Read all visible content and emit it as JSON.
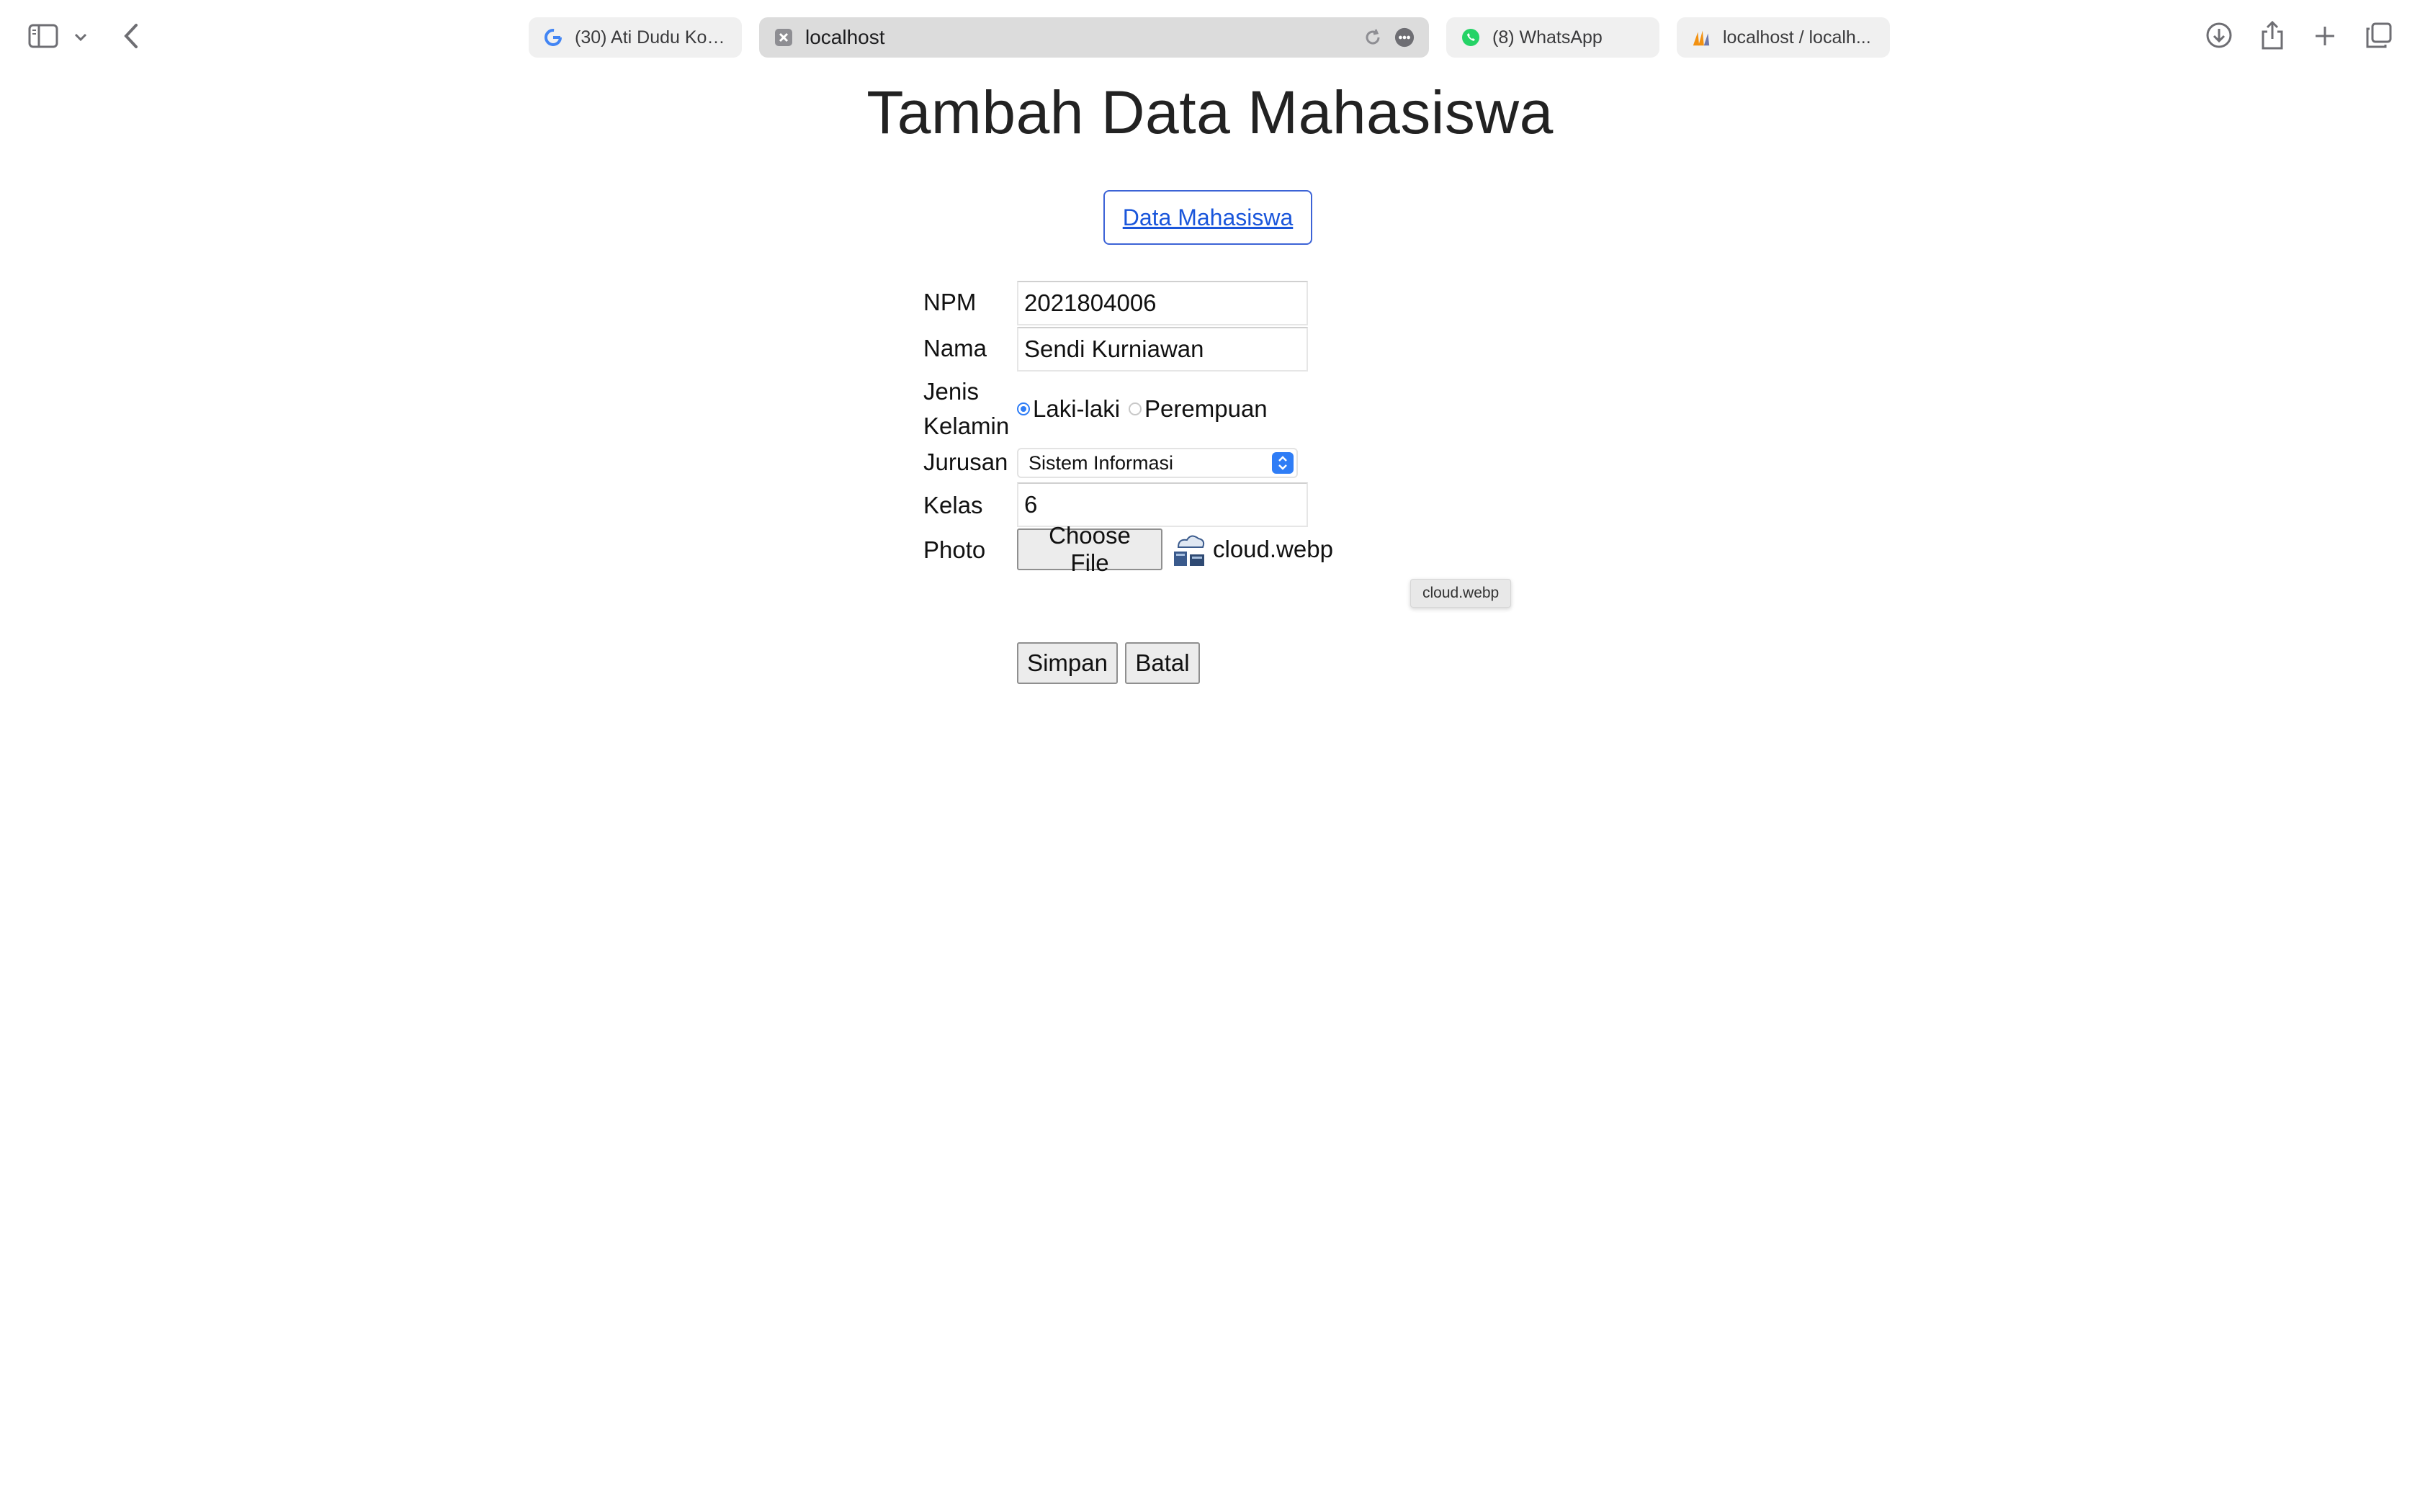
{
  "browser": {
    "tabs": [
      {
        "title": "(30) Ati Dudu Kos...",
        "icon": "google-icon"
      },
      {
        "title": "localhost",
        "icon": "localhost-favicon",
        "active": true
      },
      {
        "title": "(8) WhatsApp",
        "icon": "whatsapp-icon"
      },
      {
        "title": "localhost / localh...",
        "icon": "phpmyadmin-icon"
      }
    ]
  },
  "page": {
    "title": "Tambah Data Mahasiswa",
    "nav_link": "Data Mahasiswa"
  },
  "form": {
    "npm": {
      "label": "NPM",
      "value": "2021804006"
    },
    "nama": {
      "label": "Nama",
      "value": "Sendi Kurniawan"
    },
    "jenis_kelamin": {
      "label_line1": "Jenis",
      "label_line2": "Kelamin",
      "options": [
        "Laki-laki",
        "Perempuan"
      ],
      "selected": "Laki-laki"
    },
    "jurusan": {
      "label": "Jurusan",
      "value": "Sistem Informasi"
    },
    "kelas": {
      "label": "Kelas",
      "value": "6"
    },
    "photo": {
      "label": "Photo",
      "button": "Choose File",
      "file_name": "cloud.webp",
      "tooltip": "cloud.webp"
    },
    "submit_label": "Simpan",
    "cancel_label": "Batal"
  },
  "colors": {
    "accent": "#2f7df6",
    "link": "#1a56db"
  }
}
